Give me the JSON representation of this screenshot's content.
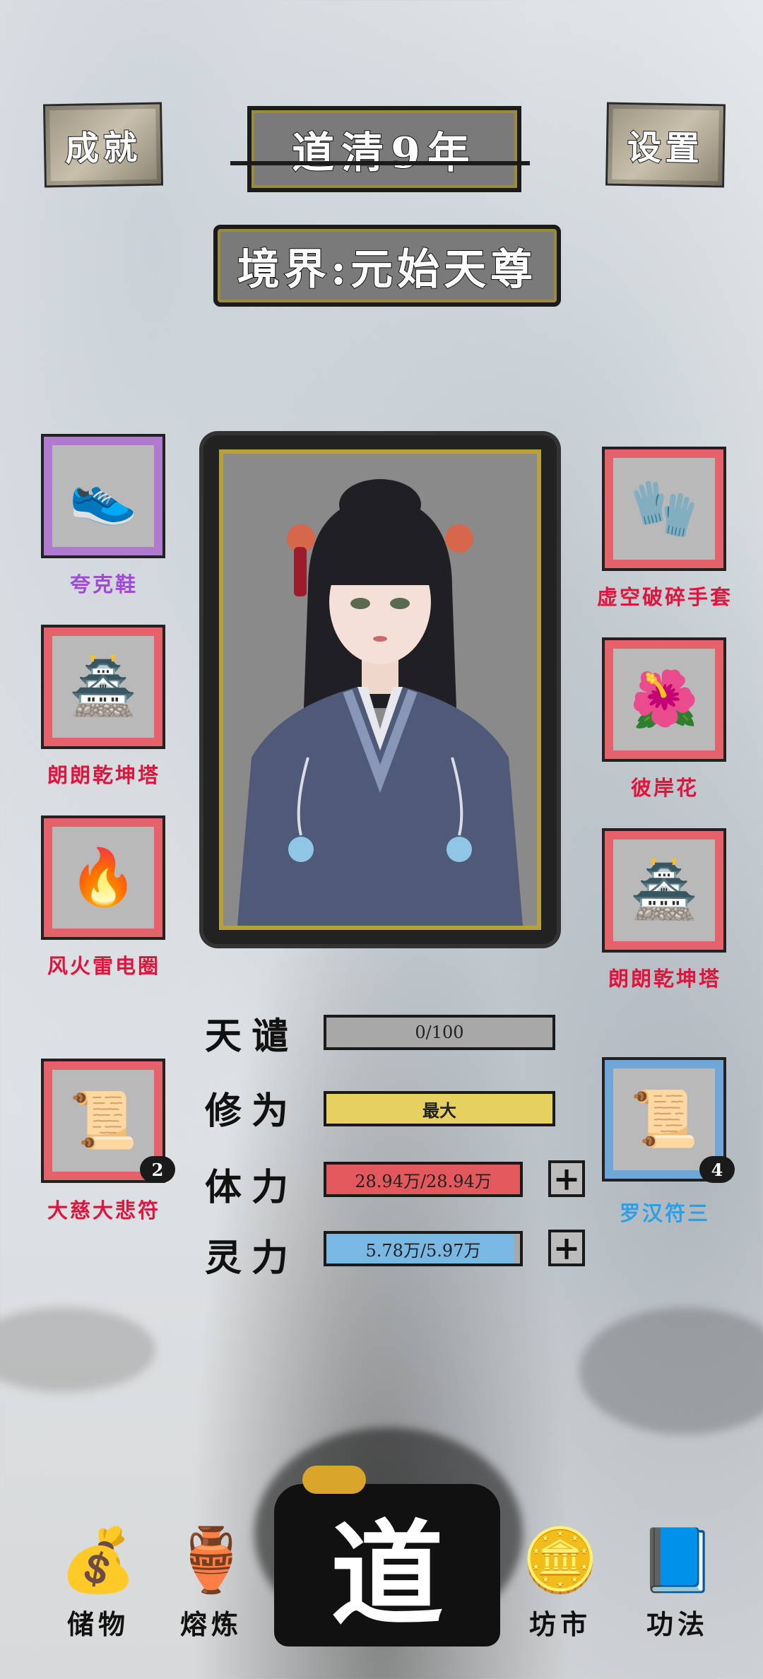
{
  "header": {
    "achievements_label": "成就",
    "year_title": "道清9年",
    "settings_label": "设置",
    "realm_label": "境界:元始天尊"
  },
  "equipment": {
    "left": [
      {
        "name": "夸克鞋",
        "color": "#a04ad8",
        "frame": "purple",
        "icon": "shoe-icon"
      },
      {
        "name": "朗朗乾坤塔",
        "color": "#e0143c",
        "frame": "red",
        "icon": "pagoda-icon"
      },
      {
        "name": "风火雷电圈",
        "color": "#e0143c",
        "frame": "red",
        "icon": "fire-ring-icon"
      },
      {
        "name": "大慈大悲符",
        "color": "#e0143c",
        "frame": "red",
        "icon": "talisman-icon",
        "count": "2"
      }
    ],
    "right": [
      {
        "name": "虚空破碎手套",
        "color": "#e0143c",
        "frame": "red",
        "icon": "glove-icon"
      },
      {
        "name": "彼岸花",
        "color": "#e0143c",
        "frame": "red",
        "icon": "spider-lily-icon"
      },
      {
        "name": "朗朗乾坤塔",
        "color": "#e0143c",
        "frame": "red",
        "icon": "pagoda-icon"
      },
      {
        "name": "罗汉符三",
        "color": "#2aa0e8",
        "frame": "blue",
        "icon": "talisman-icon",
        "count": "4"
      }
    ]
  },
  "stats": {
    "tribulation": {
      "label": "天谴",
      "value": "0/100",
      "fill": 0.0,
      "color": "#9a9a9a"
    },
    "cultivation": {
      "label": "修为",
      "value": "最大",
      "fill": 1.0,
      "color": "#e6d060"
    },
    "stamina": {
      "label": "体力",
      "value": "28.94万/28.94万",
      "fill": 1.0,
      "color": "#e2585c"
    },
    "spirit": {
      "label": "灵力",
      "value": "5.78万/5.97万",
      "fill": 0.97,
      "color": "#7ab8e4"
    },
    "plus_symbol": "+"
  },
  "nav": {
    "storage": "储物",
    "smelting": "熔炼",
    "dao": "道",
    "market": "坊市",
    "techniques": "功法"
  }
}
